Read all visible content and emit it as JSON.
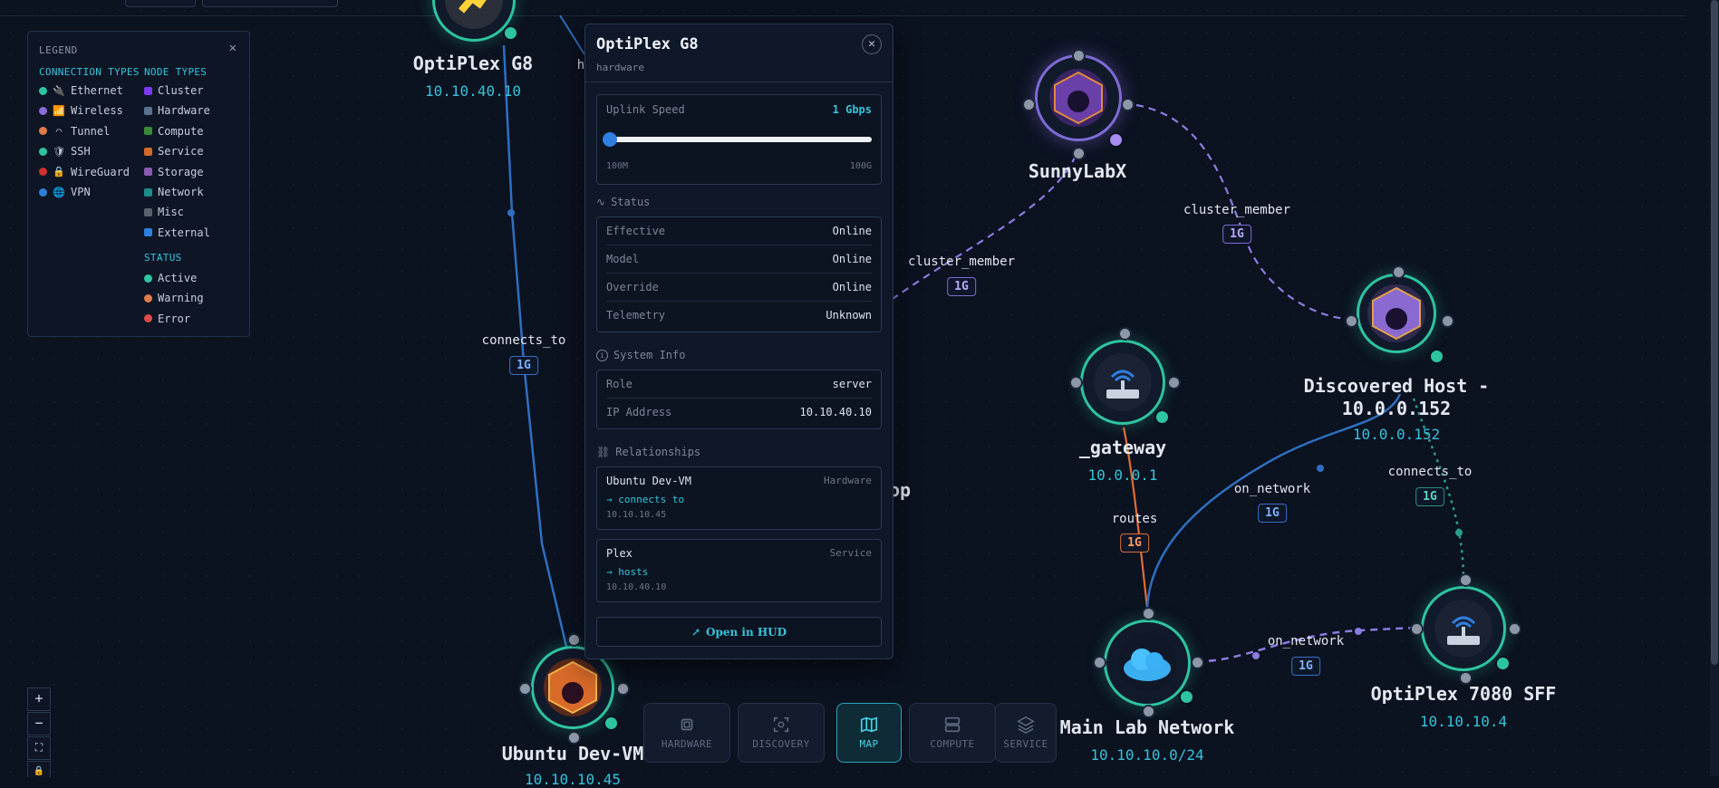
{
  "legend": {
    "title": "LEGEND",
    "connection_types_heading": "CONNECTION TYPES",
    "node_types_heading": "NODE TYPES",
    "status_heading": "STATUS",
    "connection_types": [
      {
        "label": "Ethernet",
        "color": "#2ec4a0",
        "icon": "plug-icon",
        "glyph": "🔌"
      },
      {
        "label": "Wireless",
        "color": "#8c6bd6",
        "icon": "wifi-icon",
        "glyph": "📶"
      },
      {
        "label": "Tunnel",
        "color": "#e07a4a",
        "icon": "tunnel-icon",
        "glyph": "⌒"
      },
      {
        "label": "SSH",
        "color": "#2ec4a0",
        "icon": "shield-icon",
        "glyph": "🛡"
      },
      {
        "label": "WireGuard",
        "color": "#d03030",
        "icon": "lock-icon",
        "glyph": "🔒"
      },
      {
        "label": "VPN",
        "color": "#2f7fd6",
        "icon": "globe-icon",
        "glyph": "🌐"
      }
    ],
    "node_types": [
      {
        "label": "Cluster",
        "color": "#7c3aed"
      },
      {
        "label": "Hardware",
        "color": "#5a7391"
      },
      {
        "label": "Compute",
        "color": "#3a8a3a"
      },
      {
        "label": "Service",
        "color": "#d26a28"
      },
      {
        "label": "Storage",
        "color": "#8a5ab0"
      },
      {
        "label": "Network",
        "color": "#1f8a8a"
      },
      {
        "label": "Misc",
        "color": "#5a6270"
      },
      {
        "label": "External",
        "color": "#2f7fe0"
      }
    ],
    "statuses": [
      {
        "label": "Active",
        "color": "#2ec4a0"
      },
      {
        "label": "Warning",
        "color": "#e07a4a"
      },
      {
        "label": "Error",
        "color": "#e04a4a"
      }
    ]
  },
  "panel": {
    "title": "OptiPlex G8",
    "subtitle": "hardware",
    "uplink": {
      "label": "Uplink Speed",
      "value": "1 Gbps",
      "min_label": "100M",
      "max_label": "100G",
      "level": 0.0
    },
    "status_heading": "Status",
    "status_rows": [
      {
        "k": "Effective",
        "v": "Online"
      },
      {
        "k": "Model",
        "v": "Online"
      },
      {
        "k": "Override",
        "v": "Online"
      },
      {
        "k": "Telemetry",
        "v": "Unknown"
      }
    ],
    "sysinfo_heading": "System Info",
    "sysinfo_rows": [
      {
        "k": "Role",
        "v": "server"
      },
      {
        "k": "IP Address",
        "v": "10.10.40.10"
      }
    ],
    "relationships_heading": "Relationships",
    "relationships": [
      {
        "name": "Ubuntu Dev-VM",
        "type": "Hardware",
        "verb": "→ connects to",
        "ip": "10.10.10.45"
      },
      {
        "name": "Plex",
        "type": "Service",
        "verb": "→ hosts",
        "ip": "10.10.40.10"
      }
    ],
    "open_button": "Open in HUD"
  },
  "nodes": {
    "optiplex_g8": {
      "label": "OptiPlex G8",
      "ip": "10.10.40.10"
    },
    "sunnylabx": {
      "label": "SunnyLabX"
    },
    "discovered": {
      "label_line1": "Discovered Host -",
      "label_line2": "10.0.0.152",
      "ip": "10.0.0.152"
    },
    "gateway": {
      "label": "_gateway",
      "ip": "10.0.0.1"
    },
    "main_lab": {
      "label": "Main Lab Network",
      "ip": "10.10.10.0/24"
    },
    "optiplex_7080": {
      "label": "OptiPlex 7080 SFF",
      "ip": "10.10.10.4"
    },
    "ubuntu": {
      "label": "Ubuntu Dev-VM",
      "ip": "10.10.10.45"
    },
    "partial_left": {
      "label": "h"
    },
    "partial_op": {
      "label": "op"
    }
  },
  "edges": {
    "connects_to_left": {
      "label": "connects_to",
      "speed": "1G"
    },
    "cluster_member_1": {
      "label": "cluster_member",
      "speed": "1G"
    },
    "cluster_member_2": {
      "label": "cluster_member",
      "speed": "1G"
    },
    "routes": {
      "label": "routes",
      "speed": "1G"
    },
    "on_network_1": {
      "label": "on_network",
      "speed": "1G"
    },
    "connects_to_right": {
      "label": "connects_to",
      "speed": "1G"
    },
    "on_network_2": {
      "label": "on_network",
      "speed": "1G"
    }
  },
  "nav": [
    {
      "label": "HARDWARE",
      "icon": "chip-icon"
    },
    {
      "label": "DISCOVERY",
      "icon": "scan-icon"
    },
    {
      "label": "MAP",
      "icon": "map-icon"
    },
    {
      "label": "COMPUTE",
      "icon": "server-icon"
    },
    {
      "label": "SERVICE",
      "icon": "layers-icon"
    }
  ],
  "zoom": {
    "in": "+",
    "out": "−",
    "fit": "⛶",
    "lock": "🔒"
  }
}
